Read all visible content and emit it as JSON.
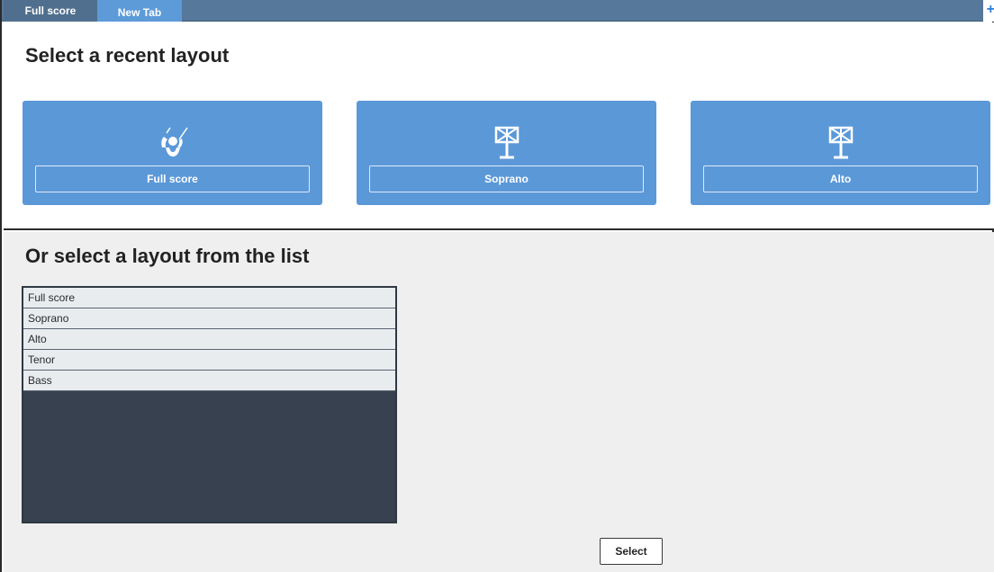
{
  "tabs": [
    {
      "label": "Full score",
      "active": false
    },
    {
      "label": "New Tab",
      "active": true
    }
  ],
  "add_tab_label": "+",
  "recent": {
    "heading": "Select a recent layout",
    "cards": [
      {
        "label": "Full score",
        "icon": "conductor-icon"
      },
      {
        "label": "Soprano",
        "icon": "music-stand-icon"
      },
      {
        "label": "Alto",
        "icon": "music-stand-icon"
      }
    ]
  },
  "list": {
    "heading": "Or select a layout from the list",
    "items": [
      "Full score",
      "Soprano",
      "Alto",
      "Tenor",
      "Bass"
    ]
  },
  "select_button": "Select",
  "colors": {
    "tabbar": "#56789a",
    "active_tab": "#5d9ad8",
    "card": "#5b98d8",
    "listbox_bg": "#37414f",
    "list_item_bg": "#e9ecef",
    "section_bg": "#efefef"
  }
}
